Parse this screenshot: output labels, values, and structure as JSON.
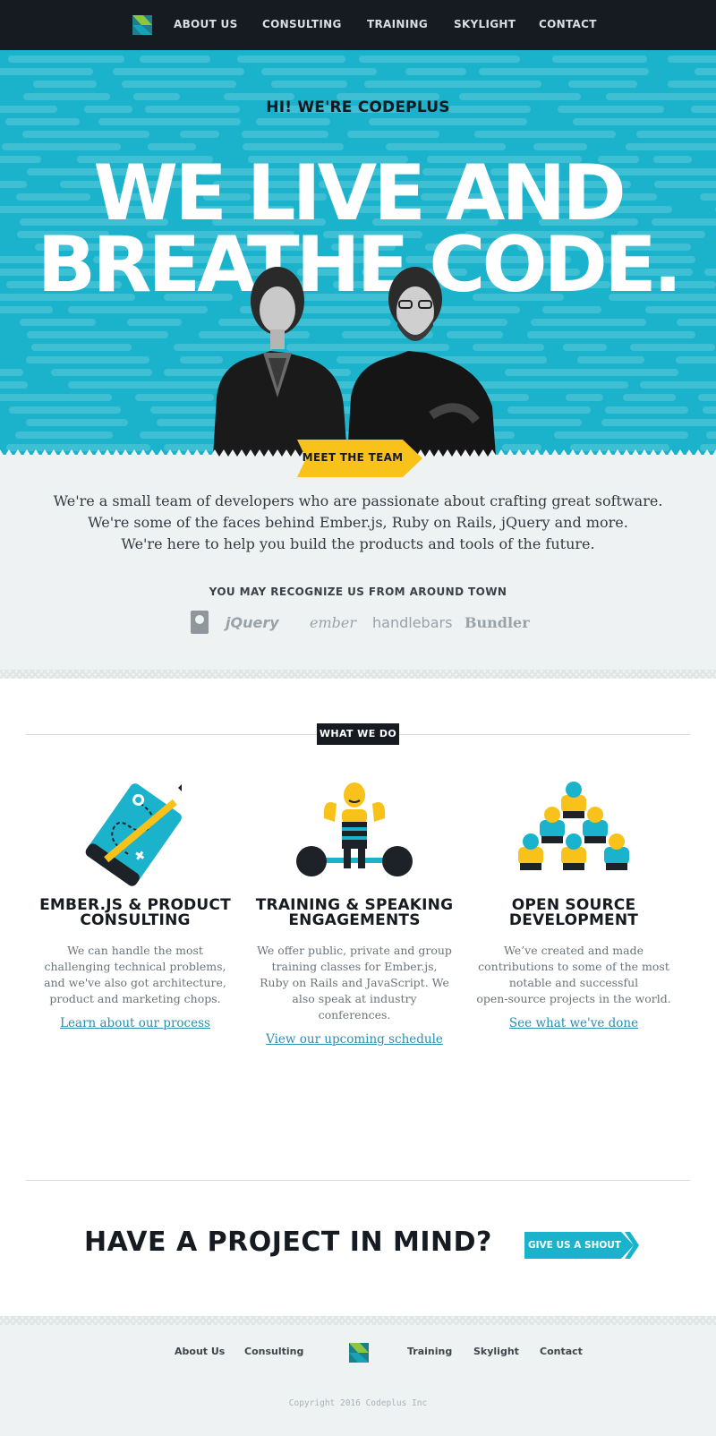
{
  "nav": {
    "items": [
      "ABOUT US",
      "CONSULTING",
      "TRAINING",
      "SKYLIGHT",
      "CONTACT"
    ]
  },
  "hero": {
    "kicker": "HI! WE'RE CODEPLUS",
    "headline_line1": "WE LIVE AND",
    "headline_line2": "BREATHE CODE.",
    "meet_button": "MEET THE TEAM"
  },
  "intro": {
    "lines": [
      "We're a small team of developers who are passionate about crafting great software.",
      "We're some of the faces behind Ember.js, Ruby on Rails, jQuery and more.",
      "We're here to help you build the products and tools of the future."
    ],
    "recognize_heading": "YOU MAY RECOGNIZE US FROM AROUND TOWN",
    "project_logos": [
      "RAILS",
      "jQuery",
      "ember",
      "handlebars",
      "Bundler"
    ]
  },
  "what_we_do": {
    "badge": "WHAT WE DO",
    "services": [
      {
        "title_line1": "EMBER.JS & PRODUCT",
        "title_line2": "CONSULTING",
        "body_lines": [
          "We can handle the most",
          "challenging technical problems,",
          "and we've also got architecture,",
          "product and marketing chops."
        ],
        "link": "Learn about our process"
      },
      {
        "title_line1": "TRAINING & SPEAKING",
        "title_line2": "ENGAGEMENTS",
        "body_lines": [
          "We offer public, private and group",
          "training classes for Ember.js,",
          "Ruby on Rails and JavaScript. We",
          "also speak at industry",
          "conferences."
        ],
        "link": "View our upcoming schedule"
      },
      {
        "title_line1": "OPEN SOURCE",
        "title_line2": "DEVELOPMENT",
        "body_lines": [
          "We’ve created and made",
          "contributions to some of the most",
          "notable and successful",
          "open-source projects in the world."
        ],
        "link": "See what we've done"
      }
    ]
  },
  "cta": {
    "title": "HAVE A PROJECT IN MIND?",
    "button": "GIVE US A SHOUT"
  },
  "footer": {
    "links": [
      "About Us",
      "Consulting",
      "Training",
      "Skylight",
      "Contact"
    ],
    "copyright": "Copyright 2016 Codeplus Inc"
  },
  "colors": {
    "nav_bg": "#161b22",
    "hero_bg": "#1bb3cb",
    "accent_yellow": "#f8c21a",
    "accent_teal": "#1bb3cb",
    "link": "#2a8fae"
  },
  "icons": [
    "codeplus-logo-icon",
    "rails-logo",
    "jquery-logo",
    "ember-logo",
    "handlebars-logo",
    "bundler-logo",
    "blueprint-pencil-icon",
    "strongman-barbell-icon",
    "human-pyramid-icon"
  ]
}
